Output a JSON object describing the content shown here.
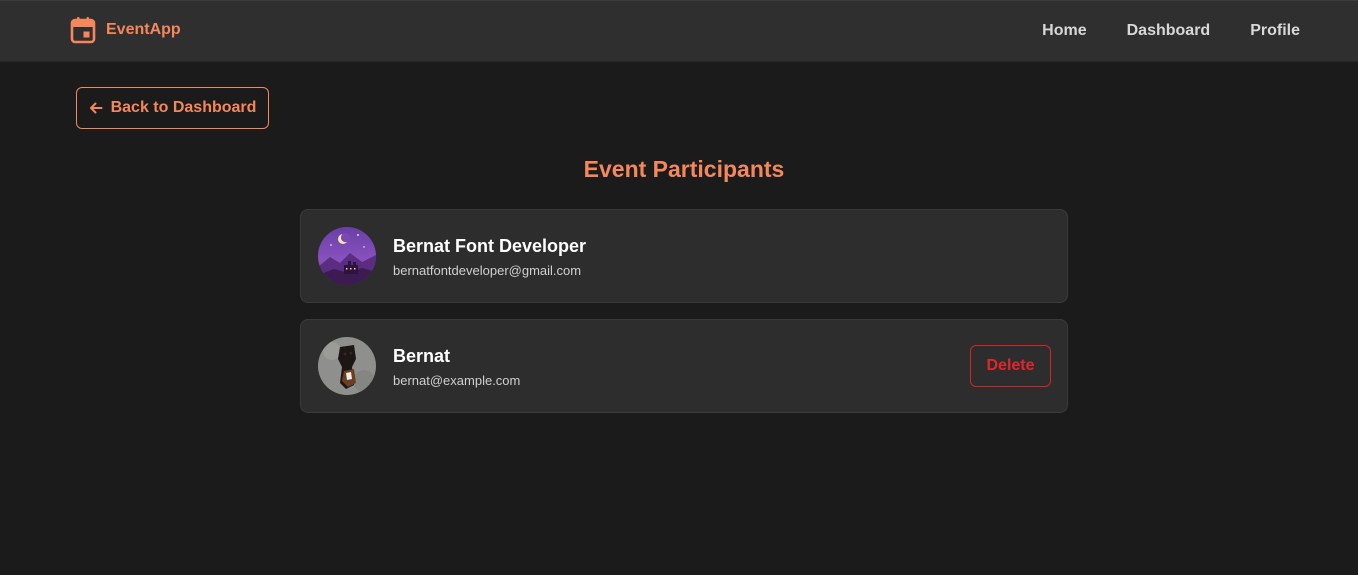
{
  "app": {
    "name": "EventApp",
    "brand_color": "#f4875b",
    "brand_icon": "calendar-icon"
  },
  "nav": {
    "links": [
      "Home",
      "Dashboard",
      "Profile"
    ]
  },
  "back_button": {
    "label": "Back to Dashboard",
    "icon": "arrow-left-icon"
  },
  "page": {
    "title": "Event Participants"
  },
  "participants": [
    {
      "name": "Bernat Font Developer",
      "email": "bernatfontdeveloper@gmail.com",
      "avatar": "purple-night-castle-avatar"
    },
    {
      "name": "Bernat",
      "email": "bernat@example.com",
      "avatar": "dog-photo-avatar",
      "action_label": "Delete",
      "action_color": "#d3232a"
    }
  ]
}
